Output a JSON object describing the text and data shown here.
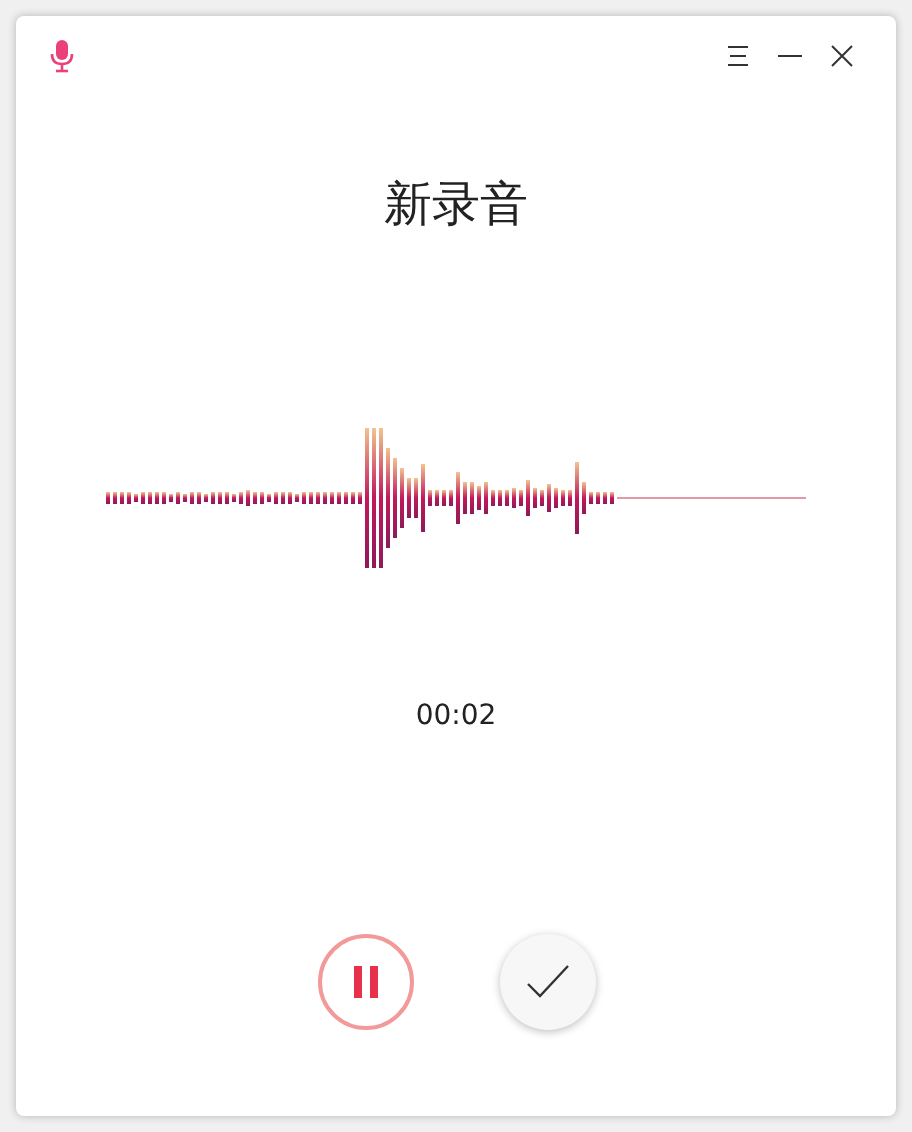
{
  "title": "新录音",
  "elapsed": "00:02",
  "recording": true
}
